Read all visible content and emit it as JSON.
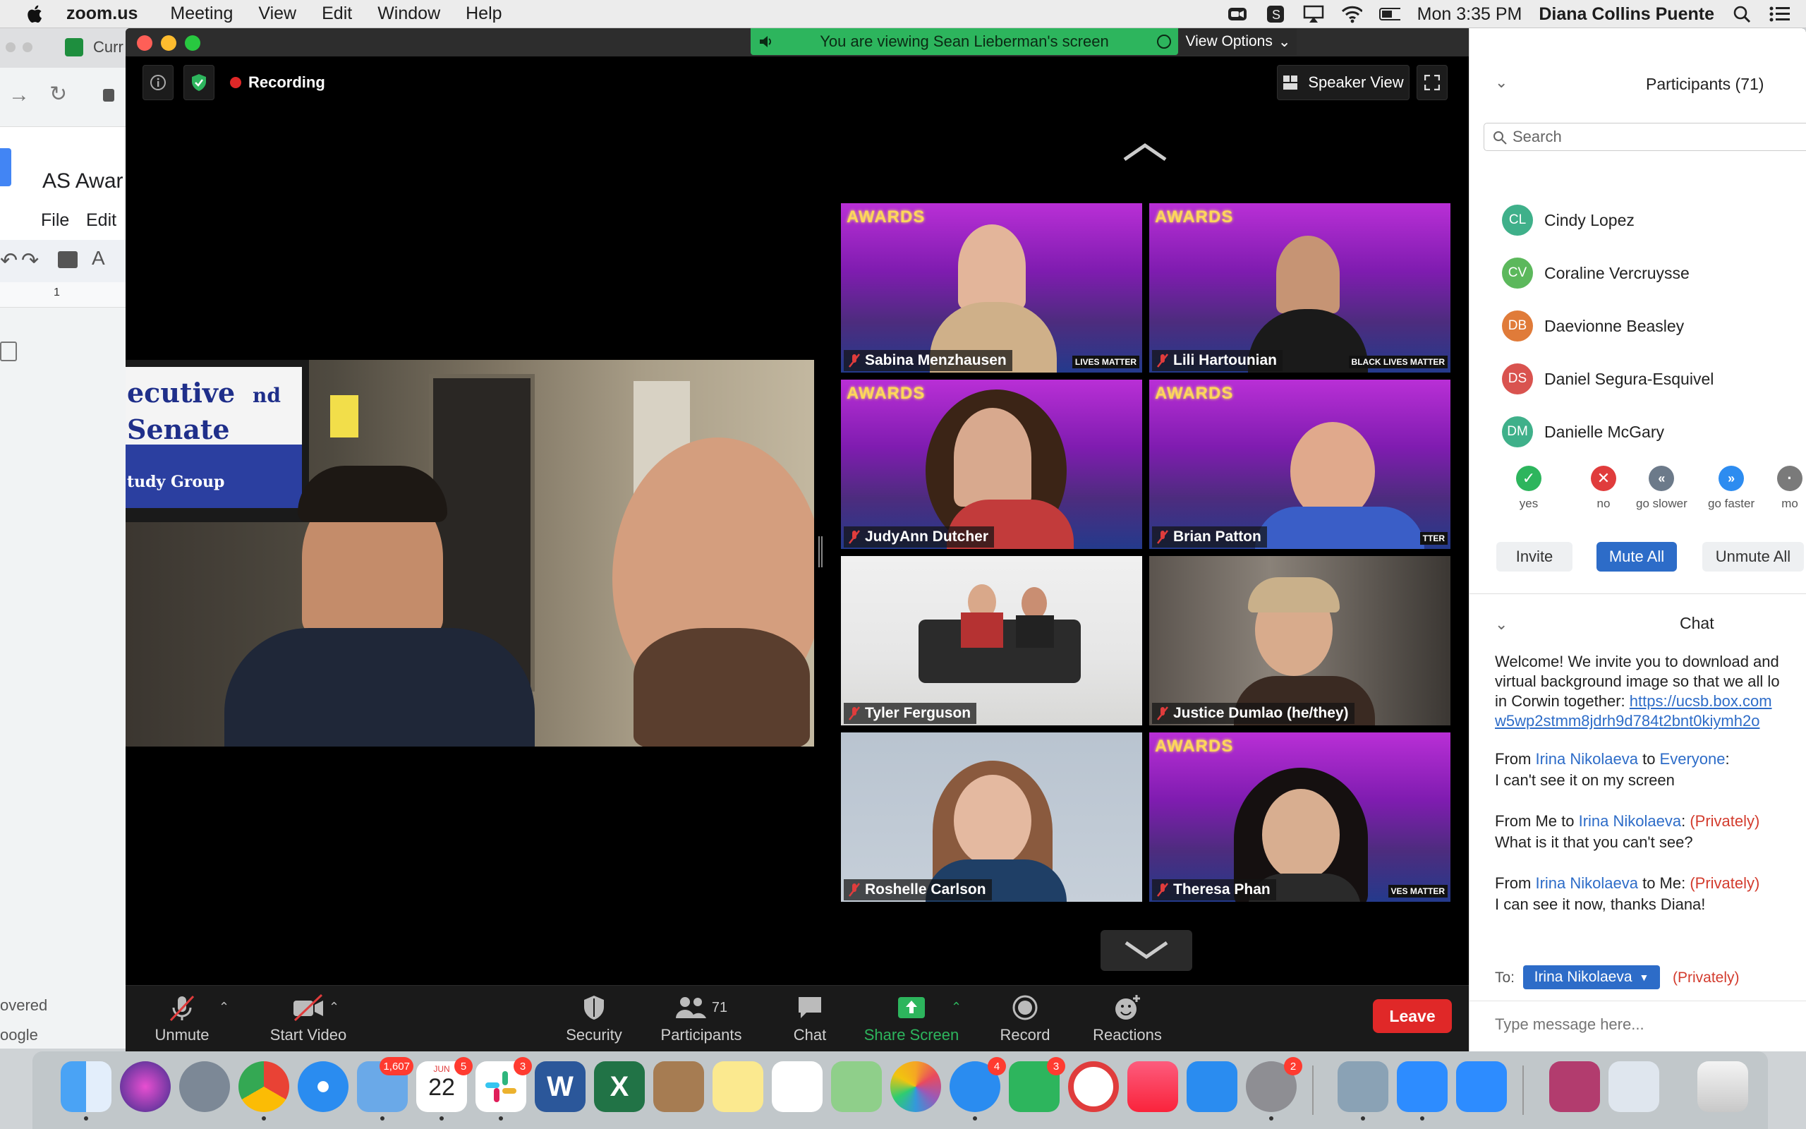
{
  "menubar": {
    "app": "zoom.us",
    "items": [
      "Meeting",
      "View",
      "Edit",
      "Window",
      "Help"
    ],
    "clock": "Mon 3:35 PM",
    "user": "Diana Collins Puente"
  },
  "background_doc": {
    "tab_label": "Curr",
    "title": "AS Awar",
    "menu_file": "File",
    "menu_edit": "Edit",
    "ruler_mark": "1",
    "sidebar_text_1": "overed",
    "sidebar_text_2": "oogle"
  },
  "zoom": {
    "banner": "You are viewing Sean Lieberman's screen",
    "view_options": "View Options",
    "recording": "Recording",
    "speaker_view": "Speaker View",
    "shared_screen": {
      "sign_line_1": "ecutive",
      "sign_line_1b": "nd",
      "sign_line_2": "Senate",
      "sign_line_3": "tudy Group"
    },
    "tiles": [
      {
        "name": "Sabina Menzhausen",
        "bg": "awards",
        "tag": "LIVES MATTER"
      },
      {
        "name": "Lili Hartounian",
        "bg": "awards",
        "tag": "BLACK LIVES MATTER"
      },
      {
        "name": "JudyAnn Dutcher",
        "bg": "awards",
        "tag": ""
      },
      {
        "name": "Brian Patton",
        "bg": "awards",
        "tag": "TTER"
      },
      {
        "name": "Tyler Ferguson",
        "bg": "room",
        "tag": ""
      },
      {
        "name": "Justice Dumlao (he/they)",
        "bg": "dark",
        "tag": ""
      },
      {
        "name": "Roshelle Carlson",
        "bg": "wall",
        "tag": ""
      },
      {
        "name": "Theresa Phan",
        "bg": "awards",
        "tag": "VES MATTER"
      }
    ],
    "awards_text": "AWARDS",
    "toolbar": {
      "unmute": "Unmute",
      "start_video": "Start Video",
      "security": "Security",
      "participants": "Participants",
      "participants_count": "71",
      "chat": "Chat",
      "share_screen": "Share Screen",
      "record": "Record",
      "reactions": "Reactions",
      "leave": "Leave"
    }
  },
  "participants_panel": {
    "title": "Participants (71)",
    "search_placeholder": "Search",
    "people": [
      {
        "initials": "CL",
        "name": "Cindy Lopez",
        "color": "#3fb08a"
      },
      {
        "initials": "CV",
        "name": "Coraline Vercruysse",
        "color": "#5cb85c"
      },
      {
        "initials": "DB",
        "name": "Daevionne Beasley",
        "color": "#e07b39"
      },
      {
        "initials": "DS",
        "name": "Daniel Segura-Esquivel",
        "color": "#d9534f"
      },
      {
        "initials": "DM",
        "name": "Danielle McGary",
        "color": "#3fb08a"
      }
    ],
    "feedback": {
      "yes": "yes",
      "no": "no",
      "slower": "go slower",
      "faster": "go faster",
      "more": "mo"
    },
    "buttons": {
      "invite": "Invite",
      "mute_all": "Mute All",
      "unmute_all": "Unmute All"
    }
  },
  "chat_panel": {
    "title": "Chat",
    "welcome_1": "Welcome! We invite you to download and",
    "welcome_2": "virtual background image so that we all lo",
    "welcome_3": "in Corwin together: ",
    "welcome_link_1": "https://ucsb.box.com",
    "welcome_link_2": "w5wp2stmm8jdrh9d784t2bnt0kiymh2o",
    "messages": [
      {
        "from_prefix": "From ",
        "from": "Irina Nikolaeva",
        "to_prefix": " to ",
        "to": "Everyone",
        "suffix": ":",
        "private": "",
        "text": "I can't see it on my screen"
      },
      {
        "from_prefix": "From Me to ",
        "from": "Irina Nikolaeva",
        "to_prefix": "",
        "to": "",
        "suffix": ": ",
        "private": "(Privately)",
        "text": "What is it that you can't see?"
      },
      {
        "from_prefix": "From ",
        "from": "Irina Nikolaeva",
        "to_prefix": " to Me: ",
        "to": "",
        "suffix": "",
        "private": "(Privately)",
        "text": "I can see it now, thanks Diana!"
      }
    ],
    "to_label": "To:",
    "to_value": "Irina Nikolaeva",
    "to_private": "(Privately)",
    "input_placeholder": "Type message here..."
  },
  "dock": {
    "badges": {
      "mail": "1,607",
      "calendar": "5",
      "calendar_month": "JUN",
      "calendar_day": "22",
      "slack": "3",
      "messages": "4",
      "facetime": "3",
      "sysprefs": "2"
    }
  }
}
